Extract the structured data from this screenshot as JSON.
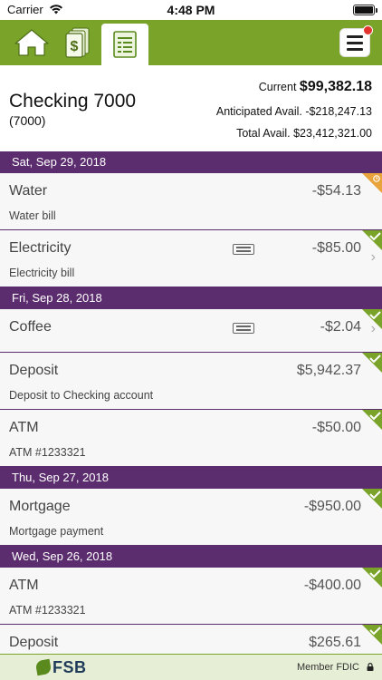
{
  "status_bar": {
    "carrier": "Carrier",
    "time": "4:48 PM"
  },
  "nav": {
    "tabs": [
      {
        "id": "home",
        "icon": "home-icon"
      },
      {
        "id": "cash",
        "icon": "dollar-bill-icon"
      },
      {
        "id": "ledger",
        "icon": "ledger-icon",
        "active": true
      }
    ],
    "menu_icon": "hamburger-menu-icon",
    "notification_color": "#e3342f"
  },
  "account": {
    "name": "Checking 7000",
    "number": "(7000)",
    "current_label": "Current",
    "current_value": "$99,382.18",
    "anticipated": "Anticipated Avail. -$218,247.13",
    "total": "Total Avail. $23,412,321.00"
  },
  "transactions": [
    {
      "date": "Sat, Sep 29, 2018",
      "items": [
        {
          "title": "Water",
          "desc": "Water bill",
          "amount": "-$54.13",
          "status": "pending",
          "memo": false,
          "chevron": false
        },
        {
          "title": "Electricity",
          "desc": "Electricity bill",
          "amount": "-$85.00",
          "status": "cleared",
          "memo": true,
          "chevron": true
        }
      ]
    },
    {
      "date": "Fri, Sep 28, 2018",
      "items": [
        {
          "title": "Coffee",
          "desc": "",
          "amount": "-$2.04",
          "status": "cleared",
          "memo": true,
          "chevron": true
        },
        {
          "title": "Deposit",
          "desc": "Deposit to Checking account",
          "amount": "$5,942.37",
          "status": "cleared",
          "memo": false,
          "chevron": false
        },
        {
          "title": "ATM",
          "desc": "ATM #1233321",
          "amount": "-$50.00",
          "status": "cleared",
          "memo": false,
          "chevron": false
        }
      ]
    },
    {
      "date": "Thu, Sep 27, 2018",
      "items": [
        {
          "title": "Mortgage",
          "desc": "Mortgage payment",
          "amount": "-$950.00",
          "status": "cleared",
          "memo": false,
          "chevron": false
        }
      ]
    },
    {
      "date": "Wed, Sep 26, 2018",
      "items": [
        {
          "title": "ATM",
          "desc": "ATM #1233321",
          "amount": "-$400.00",
          "status": "cleared",
          "memo": false,
          "chevron": false
        },
        {
          "title": "Deposit",
          "desc": "",
          "amount": "$265.61",
          "status": "cleared",
          "memo": false,
          "chevron": false
        }
      ]
    }
  ],
  "colors": {
    "brand_green": "#7aa32a",
    "header_purple": "#5b2d6e",
    "cleared": "#7aa32a",
    "pending": "#e8a33a"
  },
  "footer": {
    "logo": "FSB",
    "fdic": "Member FDIC"
  }
}
